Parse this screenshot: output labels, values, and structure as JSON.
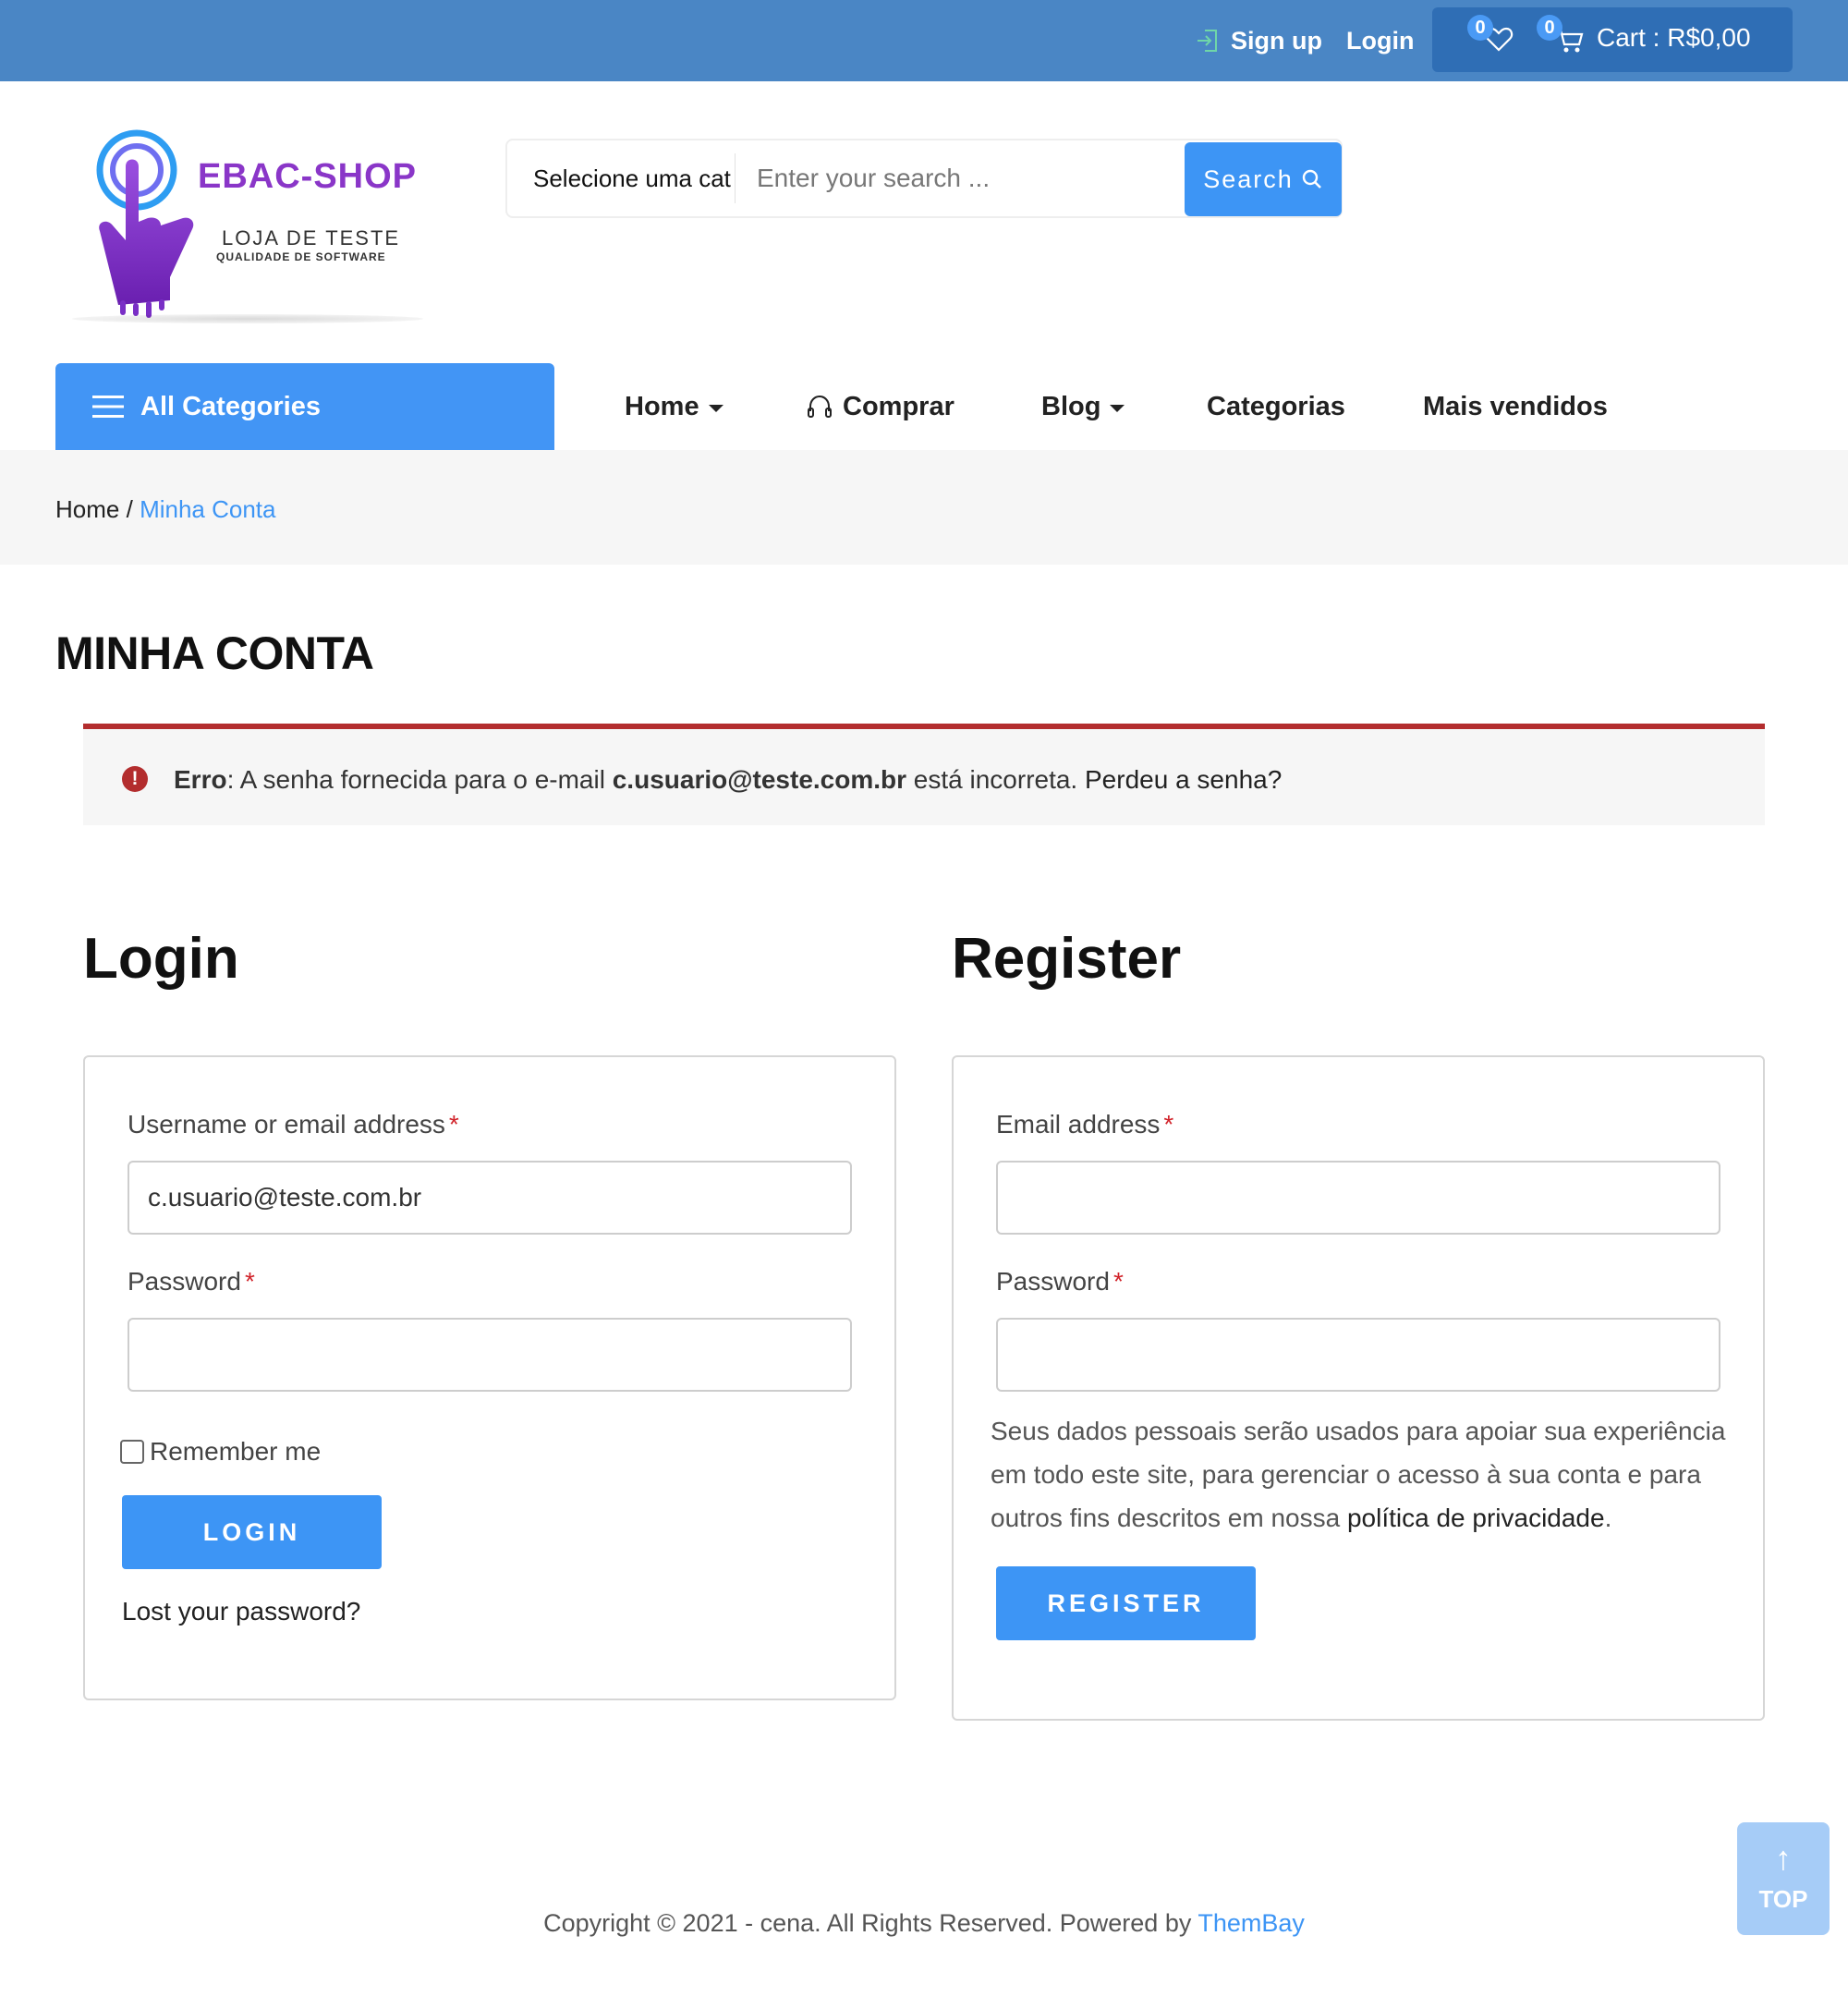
{
  "topbar": {
    "signup_label": "Sign up",
    "login_label": "Login",
    "wishlist_count": "0",
    "cart_count": "0",
    "cart_label": "Cart : R$0,00"
  },
  "logo": {
    "brand": "EBAC-SHOP",
    "subtitle": "LOJA DE TESTE",
    "tagline": "QUALIDADE DE SOFTWARE"
  },
  "search": {
    "category": "Selecione uma cat",
    "placeholder": "Enter your search ...",
    "button_label": "Search"
  },
  "nav": {
    "all_categories": "All Categories",
    "items": [
      "Home",
      "Comprar",
      "Blog",
      "Categorias",
      "Mais vendidos"
    ]
  },
  "breadcrumb": {
    "home": "Home",
    "separator": "/",
    "current": "Minha Conta"
  },
  "page_title": "MINHA CONTA",
  "notice": {
    "prefix": "Erro",
    "text1": ": A senha fornecida para o e-mail ",
    "email": "c.usuario@teste.com.br",
    "text2": " está incorreta. ",
    "link": "Perdeu a senha?"
  },
  "login": {
    "heading": "Login",
    "username_label": "Username or email address",
    "username_value": "c.usuario@teste.com.br",
    "password_label": "Password",
    "required_mark": "*",
    "remember_label": "Remember me",
    "button_label": "LOGIN",
    "lost_password": "Lost your password?"
  },
  "register": {
    "heading": "Register",
    "email_label": "Email address",
    "password_label": "Password",
    "privacy_text": "Seus dados pessoais serão usados para apoiar sua experiência em todo este site, para gerenciar o acesso à sua conta e para outros fins descritos em nossa ",
    "privacy_link": "política de privacidade",
    "privacy_end": ".",
    "button_label": "REGISTER"
  },
  "footer": {
    "copyright": "Copyright © 2021 - cena. All Rights Reserved. Powered by ",
    "powered_link": "ThemBay",
    "to_top": "TOP"
  },
  "colors": {
    "topbar": "#4a86c5",
    "accent": "#3d95f5",
    "error": "#b32d2e",
    "brand": "#8a36c8"
  }
}
